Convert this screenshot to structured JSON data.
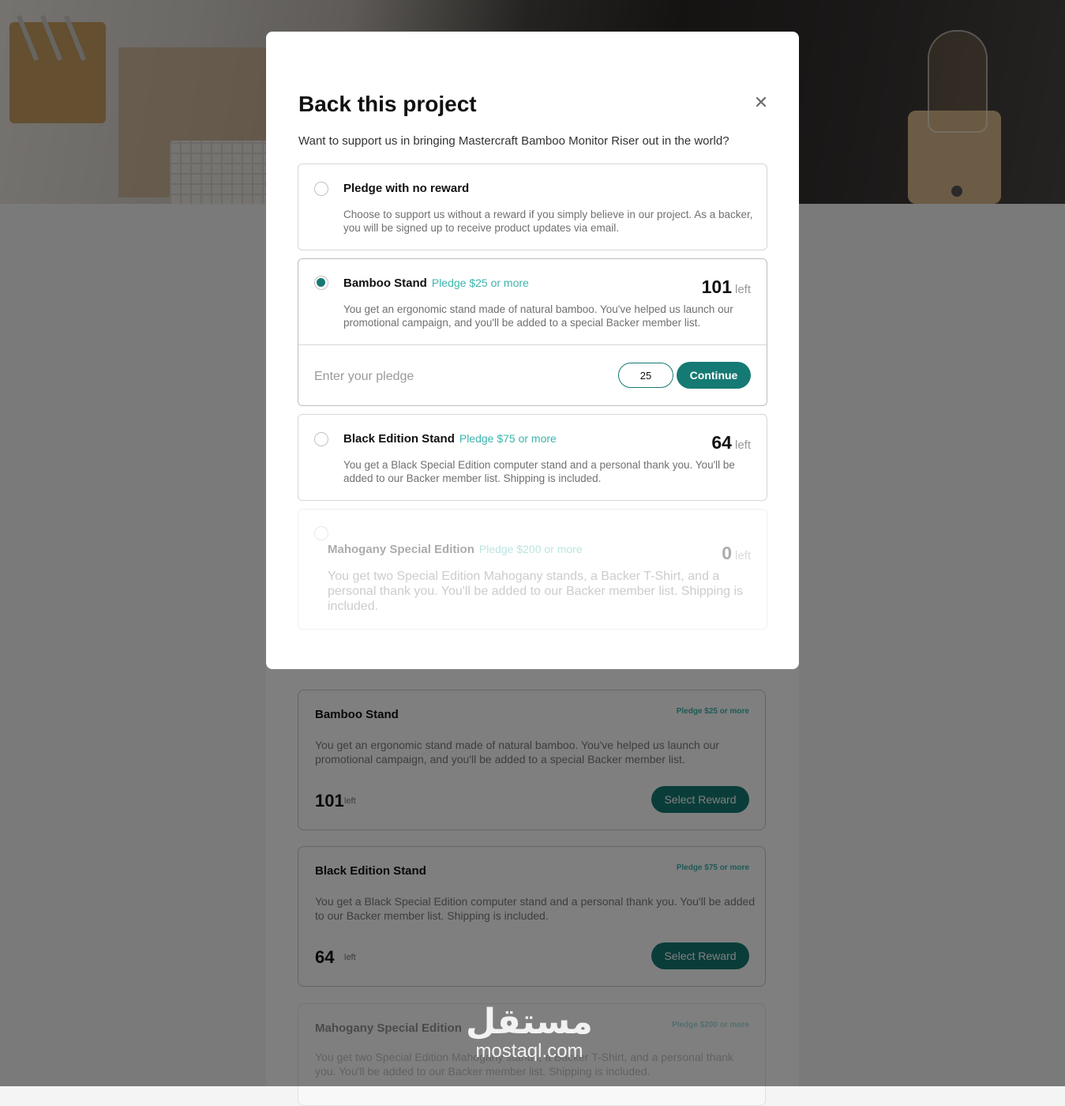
{
  "modal": {
    "title": "Back this project",
    "close_glyph": "✕",
    "subtitle": "Want to support us in bringing Mastercraft Bamboo Monitor Riser out in the world?",
    "options": [
      {
        "name": "Pledge with no reward",
        "price": "",
        "description": "Choose to support us without a reward if you simply believe in our project. As a backer, you will be signed up to receive product updates via email.",
        "selected": false
      },
      {
        "name": "Bamboo Stand",
        "price": "Pledge $25 or more",
        "count": "101",
        "left_label": "left",
        "description": "You get an ergonomic stand made of natural bamboo. You've helped us launch our promotional campaign, and you'll be added to a special Backer member list.",
        "selected": true,
        "pledge_label": "Enter your pledge",
        "pledge_value": "25",
        "continue_label": "Continue"
      },
      {
        "name": "Black Edition Stand",
        "price": "Pledge $75 or more",
        "count": "64",
        "left_label": "left",
        "description": "You get a Black Special Edition computer stand and a personal thank you. You'll be added to our Backer member list. Shipping is included.",
        "selected": false
      },
      {
        "name": "Mahogany Special Edition",
        "price": "Pledge $200 or more",
        "count": "0",
        "left_label": "left",
        "description": "You get two Special Edition Mahogany stands, a Backer T-Shirt, and a personal thank you. You'll be added to our Backer member list. Shipping is included.",
        "selected": false,
        "disabled": true
      }
    ]
  },
  "background_rewards": [
    {
      "name": "Bamboo Stand",
      "price": "Pledge $25 or more",
      "description": "You get an ergonomic stand made of natural bamboo. You've helped us launch our promotional campaign, and you'll be added to a special Backer member list.",
      "count": "101",
      "left_label": "left",
      "button": "Select Reward"
    },
    {
      "name": "Black Edition Stand",
      "price": "Pledge $75 or more",
      "description": "You get a Black Special Edition computer stand and a personal thank you. You'll be added to our Backer member list. Shipping is included.",
      "count": "64",
      "left_label": "left",
      "button": "Select Reward"
    },
    {
      "name": "Mahogany Special Edition",
      "price": "Pledge $200 or more",
      "description": "You get two Special Edition Mahogany stands, a Backer T-Shirt, and a personal thank you. You'll be added to our Backer member list. Shipping is included."
    }
  ],
  "watermark": {
    "arabic": "مستقل",
    "domain": "mostaql.com"
  },
  "colors": {
    "accent": "#157a74",
    "accent_light": "#3cb4ac",
    "overlay": "rgba(0,0,0,0.5)"
  }
}
